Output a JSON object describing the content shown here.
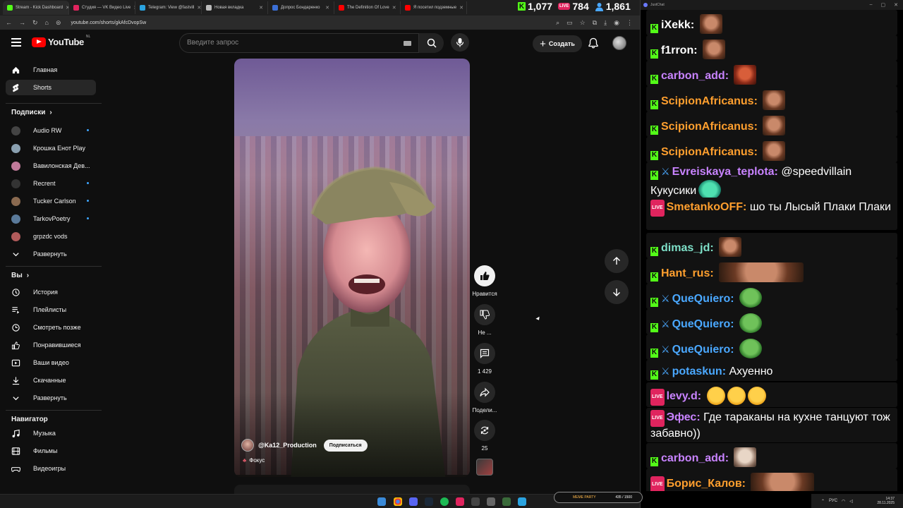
{
  "browser": {
    "tabs": [
      {
        "label": "Stream - Kick Dashboard",
        "color": "#53fc18"
      },
      {
        "label": "Студия — VK Видео Live",
        "color": "#e0245e"
      },
      {
        "label": "Telegram: View @fastvill",
        "color": "#2aa3e0"
      },
      {
        "label": "Новая вкладка",
        "color": "#bbbbbb"
      },
      {
        "label": "Допрос Бондаренко",
        "color": "#3b6fd6"
      },
      {
        "label": "The Definition Of Love",
        "color": "#ff0000"
      },
      {
        "label": "Я посетил подземные",
        "color": "#ff0000"
      }
    ],
    "url": "youtube.com/shorts/gkAfcDvopSw"
  },
  "stream_stats": {
    "kick": "1,077",
    "vk": "784",
    "viewers": "1,861"
  },
  "youtube": {
    "logo_text": "YouTube",
    "logo_region": "NL",
    "search_placeholder": "Введите запрос",
    "create_label": "Создать",
    "sidebar": {
      "main": [
        {
          "label": "Главная",
          "icon": "home-icon"
        },
        {
          "label": "Shorts",
          "icon": "shorts-icon"
        }
      ],
      "subs_title": "Подписки",
      "subs": [
        {
          "label": "Audio RW",
          "color": "#444444",
          "dot": true
        },
        {
          "label": "Крошка Енот Play",
          "color": "#8aa0b0",
          "dot": false
        },
        {
          "label": "Вавилонская Дев...",
          "color": "#c07a9a",
          "dot": false
        },
        {
          "label": "Recrent",
          "color": "#333333",
          "dot": true
        },
        {
          "label": "Tucker Carlson",
          "color": "#8a6a50",
          "dot": true
        },
        {
          "label": "TarkovPoetry",
          "color": "#5a7a9a",
          "dot": true
        },
        {
          "label": "grpzdc vods",
          "color": "#b05a5a",
          "dot": false
        }
      ],
      "subs_expand": "Развернуть",
      "you_title": "Вы",
      "you": [
        {
          "label": "История",
          "icon": "history-icon"
        },
        {
          "label": "Плейлисты",
          "icon": "playlists-icon"
        },
        {
          "label": "Смотреть позже",
          "icon": "watch-later-icon"
        },
        {
          "label": "Понравившиеся",
          "icon": "liked-icon"
        },
        {
          "label": "Ваши видео",
          "icon": "your-videos-icon"
        },
        {
          "label": "Скачанные",
          "icon": "downloads-icon"
        }
      ],
      "you_expand": "Развернуть",
      "nav_title": "Навигатор",
      "nav": [
        {
          "label": "Музыка",
          "icon": "music-icon"
        },
        {
          "label": "Фильмы",
          "icon": "films-icon"
        },
        {
          "label": "Видеоигры",
          "icon": "gaming-icon"
        }
      ]
    },
    "short": {
      "channel": "@Ka12_Production",
      "subscribe": "Подписаться",
      "tag": "Фокус",
      "actions": {
        "like": "Нравится",
        "dislike": "Не ...",
        "comments": "1 429",
        "share": "Подели...",
        "remix": "25"
      }
    }
  },
  "chat": {
    "window_title": "JustChat",
    "messages": [
      {
        "badges": [
          "kick"
        ],
        "user": "iXekk",
        "color": "#ffffff",
        "text": "",
        "emotes": [
          "face"
        ]
      },
      {
        "badges": [
          "kick"
        ],
        "user": "f1rron",
        "color": "#ffffff",
        "text": "",
        "emotes": [
          "face"
        ]
      },
      {
        "badges": [
          "kick"
        ],
        "user": "carbon_add",
        "color": "#c883ff",
        "text": "",
        "emotes": [
          "angry"
        ]
      },
      {
        "badges": [
          "kick"
        ],
        "user": "ScipionAfricanus",
        "color": "#ff9f2e",
        "text": "",
        "emotes": [
          "face"
        ]
      },
      {
        "badges": [
          "kick"
        ],
        "user": "ScipionAfricanus",
        "color": "#ff9f2e",
        "text": "",
        "emotes": [
          "face"
        ]
      },
      {
        "badges": [
          "kick"
        ],
        "user": "ScipionAfricanus",
        "color": "#ff9f2e",
        "text": "",
        "emotes": [
          "face"
        ]
      },
      {
        "badges": [
          "kick",
          "sword"
        ],
        "user": "Evreiskaya_teplota",
        "color": "#c883ff",
        "text": "@speedvillain Кукусики",
        "emotes": [
          "cat"
        ]
      },
      {
        "badges": [
          "live"
        ],
        "user": "SmetankoOFF",
        "color": "#ff9f2e",
        "text": "шо ты Лысый Плаки Плаки",
        "emotes": []
      },
      {
        "badges": [
          "kick"
        ],
        "user": "dimas_jd",
        "color": "#7ee0c8",
        "text": "",
        "emotes": [
          "face"
        ]
      },
      {
        "badges": [
          "kick"
        ],
        "user": "Hant_rus",
        "color": "#ff9f2e",
        "text": "",
        "emotes": [
          "wide"
        ]
      },
      {
        "badges": [
          "kick",
          "sword"
        ],
        "user": "QueQuiero",
        "color": "#4aa8ff",
        "text": "",
        "emotes": [
          "pepe"
        ]
      },
      {
        "badges": [
          "kick",
          "sword"
        ],
        "user": "QueQuiero",
        "color": "#4aa8ff",
        "text": "",
        "emotes": [
          "pepe"
        ]
      },
      {
        "badges": [
          "kick",
          "sword"
        ],
        "user": "QueQuiero",
        "color": "#4aa8ff",
        "text": "",
        "emotes": [
          "pepe"
        ]
      },
      {
        "badges": [
          "kick",
          "sword"
        ],
        "user": "potaskun",
        "color": "#4aa8ff",
        "text": "Ахуенно",
        "emotes": []
      },
      {
        "badges": [
          "live"
        ],
        "user": "levy.d",
        "color": "#c883ff",
        "text": "",
        "emotes": [
          "laugh",
          "laugh",
          "laugh"
        ]
      },
      {
        "badges": [
          "live"
        ],
        "user": "Эфес",
        "color": "#c883ff",
        "text": "Где тараканы на кухне танцуют тож забавно))",
        "emotes": []
      },
      {
        "badges": [
          "kick"
        ],
        "user": "carbon_add",
        "color": "#c883ff",
        "text": "",
        "emotes": [
          "pale"
        ]
      },
      {
        "badges": [
          "live"
        ],
        "user": "Борис_Калов",
        "color": "#ff9f2e",
        "text": "",
        "emotes": [
          "triple"
        ]
      }
    ]
  },
  "taskbar": {
    "meme_label": "MEME PARTY",
    "meme_count": "435 / 1500",
    "lang": "РУС",
    "time": "14:37",
    "date": "28.11.2025"
  }
}
